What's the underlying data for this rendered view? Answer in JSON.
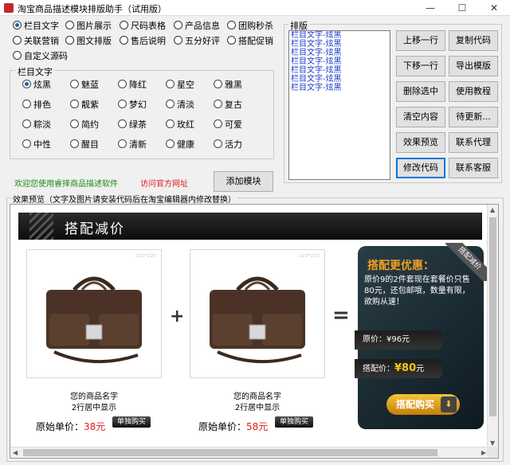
{
  "window": {
    "title": "淘宝商品描述模块排版助手（试用版）",
    "minimize": "—",
    "maximize": "☐",
    "close": "✕"
  },
  "modules": [
    {
      "label": "栏目文字",
      "checked": true
    },
    {
      "label": "图片展示",
      "checked": false
    },
    {
      "label": "尺码表格",
      "checked": false
    },
    {
      "label": "产品信息",
      "checked": false
    },
    {
      "label": "团购秒杀",
      "checked": false
    },
    {
      "label": "关联营销",
      "checked": false
    },
    {
      "label": "图文排版",
      "checked": false
    },
    {
      "label": "售后说明",
      "checked": false
    },
    {
      "label": "五分好评",
      "checked": false
    },
    {
      "label": "搭配促销",
      "checked": false
    },
    {
      "label": "自定义源码",
      "checked": false
    }
  ],
  "style_group": {
    "legend": "栏目文字",
    "options": [
      {
        "label": "炫黑",
        "selected": true
      },
      {
        "label": "魅蓝",
        "selected": false
      },
      {
        "label": "降红",
        "selected": false
      },
      {
        "label": "星空",
        "selected": false
      },
      {
        "label": "雅黑",
        "selected": false
      },
      {
        "label": "排色",
        "selected": false
      },
      {
        "label": "靓紫",
        "selected": false
      },
      {
        "label": "梦幻",
        "selected": false
      },
      {
        "label": "清淡",
        "selected": false
      },
      {
        "label": "复古",
        "selected": false
      },
      {
        "label": "粽淡",
        "selected": false
      },
      {
        "label": "简约",
        "selected": false
      },
      {
        "label": "绿茶",
        "selected": false
      },
      {
        "label": "玫红",
        "selected": false
      },
      {
        "label": "可爱",
        "selected": false
      },
      {
        "label": "中性",
        "selected": false
      },
      {
        "label": "醒目",
        "selected": false
      },
      {
        "label": "清新",
        "selected": false
      },
      {
        "label": "健康",
        "selected": false
      },
      {
        "label": "活力",
        "selected": false
      }
    ]
  },
  "footer_links": {
    "welcome": "欢迎您使用睿择商品描述软件",
    "visit": "访问官方网址"
  },
  "add_module_button": "添加模块",
  "layout_group": {
    "legend": "排版",
    "items": [
      "栏目文字-炫黑",
      "栏目文字-炫黑",
      "栏目文字-炫黑",
      "栏目文字-炫黑",
      "栏目文字-炫黑",
      "栏目文字-炫黑",
      "栏目文字-炫黑"
    ],
    "buttons": {
      "move_up": "上移一行",
      "copy_code": "复制代码",
      "move_down": "下移一行",
      "export_template": "导出模版",
      "delete_selected": "删除选中",
      "tutorial": "使用教程",
      "clear": "清空内容",
      "pending": "待更新...",
      "preview": "效果预览",
      "contact_agent": "联系代理",
      "edit_code": "修改代码",
      "contact_service": "联系客服"
    }
  },
  "preview": {
    "label": "效果预览（文字及图片请安装代码后在淘宝编辑器内修改替换）",
    "banner_title": "搭配减价",
    "products": [
      {
        "tag": "220*220",
        "name": "您的商品名字",
        "subtitle": "2行居中显示",
        "price_label": "原始单价：",
        "price": "38",
        "unit": "元",
        "buy": "单独购买"
      },
      {
        "tag": "220*220",
        "name": "您的商品名字",
        "subtitle": "2行居中显示",
        "price_label": "原始单价：",
        "price": "58",
        "unit": "元",
        "buy": "单独购买"
      }
    ],
    "plus": "+",
    "equals": "=",
    "promo": {
      "title": "搭配更优惠：",
      "description": "原价9的2件套现在套餐价只售80元，还包邮哦，数量有限，欲购从速！",
      "ribbon": "搭配减价",
      "original_label": "原价：",
      "original_price": "¥96元",
      "combo_label": "搭配价：",
      "combo_currency": "¥",
      "combo_price": "80",
      "combo_unit": "元",
      "buy_button": "搭配购买",
      "cart_icon": "⬇"
    }
  }
}
